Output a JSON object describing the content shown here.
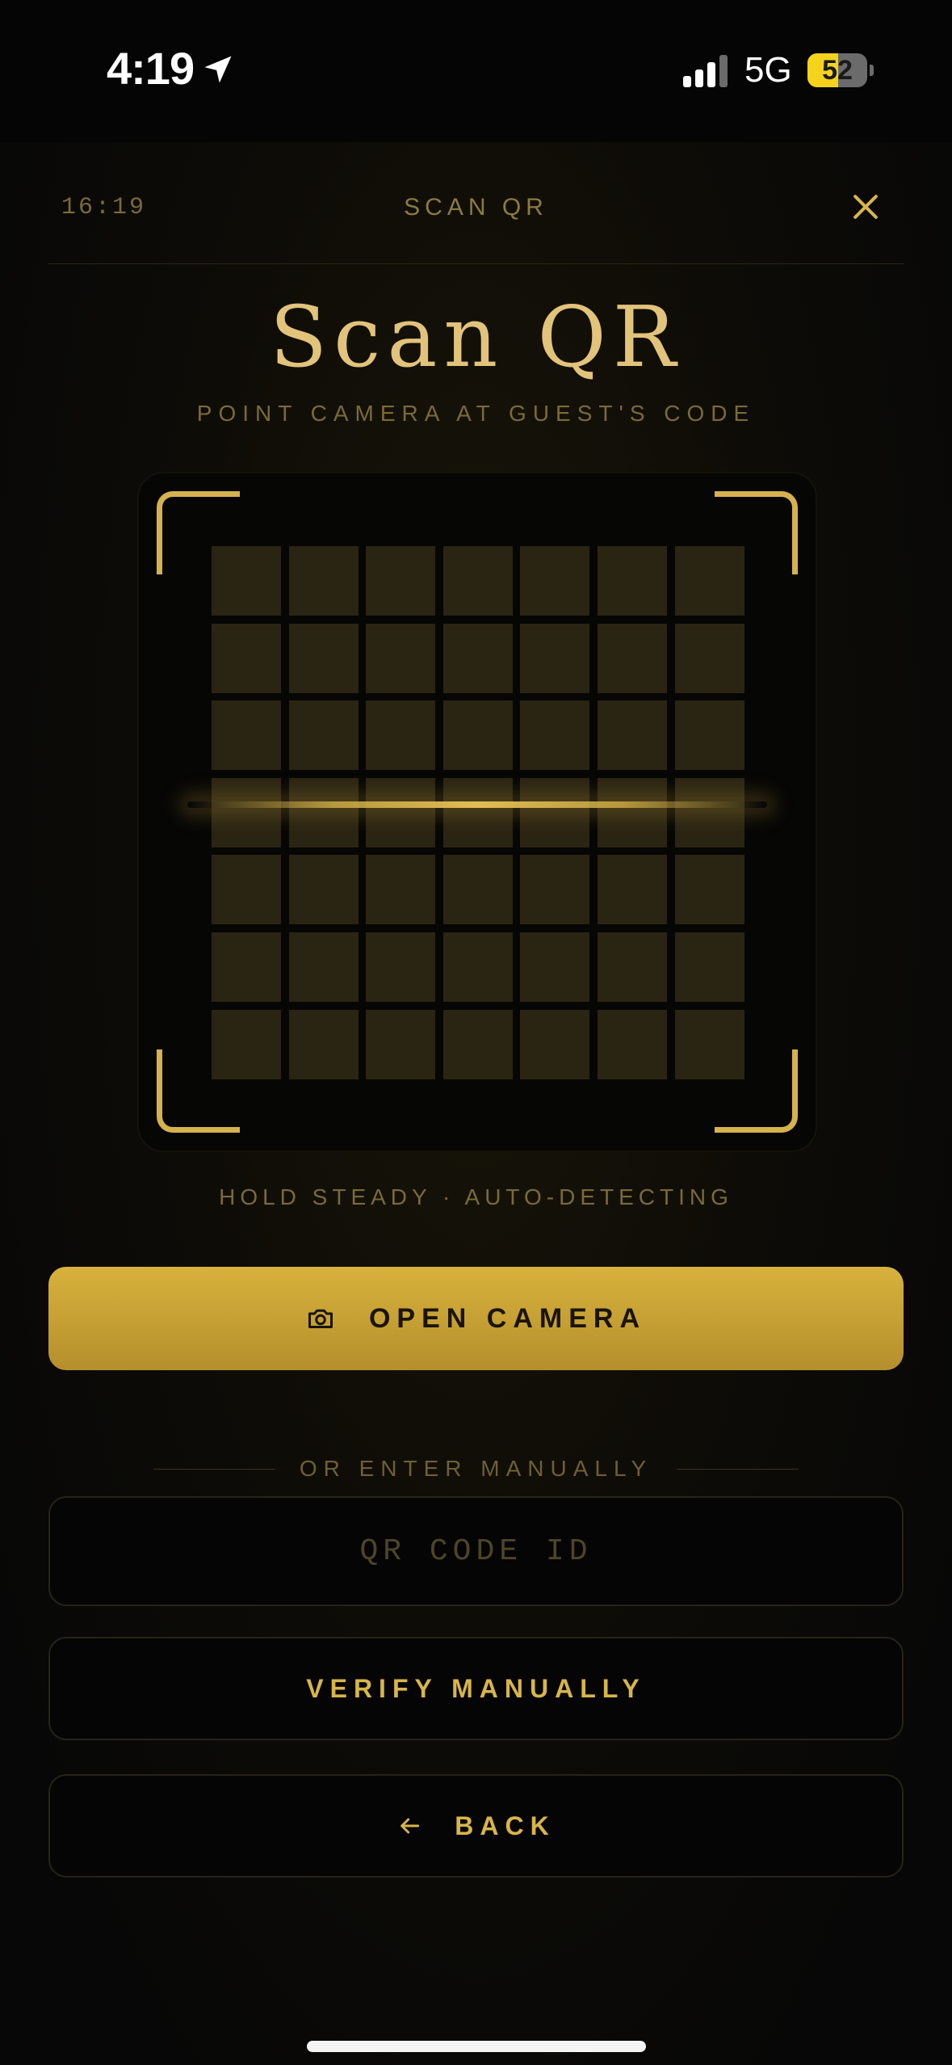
{
  "status_bar": {
    "time": "4:19",
    "network": "5G",
    "battery_level": "52",
    "battery_fraction": 0.52
  },
  "header": {
    "time": "16:19",
    "title": "SCAN QR"
  },
  "main": {
    "heading": "Scan QR",
    "subheading": "POINT CAMERA AT GUEST'S CODE",
    "hint": "HOLD STEADY · AUTO-DETECTING",
    "open_camera_label": "OPEN CAMERA",
    "divider_label": "OR ENTER MANUALLY",
    "qr_input_placeholder": "QR CODE ID",
    "qr_input_value": "",
    "verify_label": "VERIFY MANUALLY",
    "back_label": "BACK"
  },
  "icons": {
    "location": "location-arrow-icon",
    "signal": "cellular-signal-icon",
    "battery": "battery-charging-icon",
    "close": "close-icon",
    "camera": "camera-icon",
    "back": "arrow-left-icon"
  },
  "colors": {
    "accent": "#d8b54a",
    "background": "#080808",
    "grid_cell": "#2a2412"
  }
}
